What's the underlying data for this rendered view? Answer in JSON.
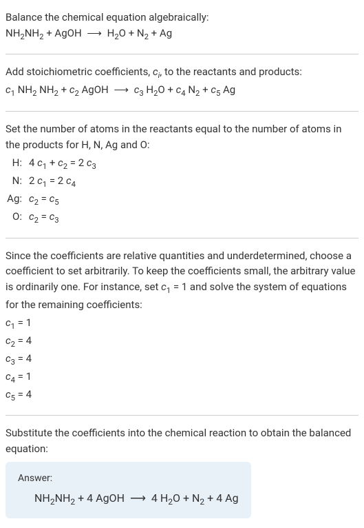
{
  "chart_data": {
    "type": "table",
    "title": "Atom balance equations",
    "elements": [
      "H",
      "N",
      "Ag",
      "O"
    ],
    "equations": {
      "H": "4 c1 + c2 = 2 c3",
      "N": "2 c1 = 2 c4",
      "Ag": "c2 = c5",
      "O": "c2 = c3"
    },
    "solution": {
      "c1": 1,
      "c2": 4,
      "c3": 4,
      "c4": 1,
      "c5": 4
    },
    "reactants": [
      {
        "coefficient": 1,
        "formula": "NH2NH2"
      },
      {
        "coefficient": 4,
        "formula": "AgOH"
      }
    ],
    "products": [
      {
        "coefficient": 4,
        "formula": "H2O"
      },
      {
        "coefficient": 1,
        "formula": "N2"
      },
      {
        "coefficient": 4,
        "formula": "Ag"
      }
    ]
  },
  "s1": {
    "line1": "Balance the chemical equation algebraically:",
    "eq_a": "NH",
    "eq_b": "NH",
    "eq_c": " + AgOH ",
    "arrow": "⟶",
    "eq_d": " H",
    "eq_e": "O + N",
    "eq_f": " + Ag",
    "two": "2"
  },
  "s2": {
    "line1a": "Add stoichiometric coefficients, ",
    "ci": "c",
    "ci_sub": "i",
    "line1b": ", to the reactants and products:",
    "c1": "c",
    "c2": "c",
    "c3": "c",
    "c4": "c",
    "c5": "c",
    "n1": "1",
    "n2": "2",
    "n3": "3",
    "n4": "4",
    "n5": "5",
    "sp_nh": " NH",
    "sp_agoh": " AgOH ",
    "sp_h": " H",
    "sp_o_n": "O + ",
    "sp_n": " N",
    "sp_plus": " + ",
    "sp_ag": " Ag",
    "arrow": "⟶",
    "two": "2"
  },
  "s3": {
    "line1": "Set the number of atoms in the reactants equal to the number of atoms in the products for H, N, Ag and O:",
    "H_label": "H:",
    "N_label": "N:",
    "Ag_label": "Ag:",
    "O_label": "O:",
    "H_a": "4 ",
    "H_c1": "c",
    "H_1": "1",
    "H_b": " + ",
    "H_c2": "c",
    "H_2": "2",
    "H_c": " = 2 ",
    "H_c3": "c",
    "H_3": "3",
    "N_a": "2 ",
    "N_c1": "c",
    "N_1": "1",
    "N_b": " = 2 ",
    "N_c4": "c",
    "N_4": "4",
    "Ag_c2": "c",
    "Ag_2": "2",
    "Ag_b": " = ",
    "Ag_c5": "c",
    "Ag_5": "5",
    "O_c2": "c",
    "O_2": "2",
    "O_b": " = ",
    "O_c3": "c",
    "O_3": "3"
  },
  "s4": {
    "line1a": "Since the coefficients are relative quantities and underdetermined, choose a coefficient to set arbitrarily. To keep the coefficients small, the arbitrary value is ordinarily one. For instance, set ",
    "c1": "c",
    "n1": "1",
    "line1b": " = 1 and solve the system of equations for the remaining coefficients:",
    "r1_c": "c",
    "r1_n": "1",
    "r1_v": " = 1",
    "r2_c": "c",
    "r2_n": "2",
    "r2_v": " = 4",
    "r3_c": "c",
    "r3_n": "3",
    "r3_v": " = 4",
    "r4_c": "c",
    "r4_n": "4",
    "r4_v": " = 1",
    "r5_c": "c",
    "r5_n": "5",
    "r5_v": " = 4"
  },
  "s5": {
    "line1": "Substitute the coefficients into the chemical reaction to obtain the balanced equation:"
  },
  "answer": {
    "label": "Answer:",
    "a": "NH",
    "b": "NH",
    "c": " + 4 AgOH ",
    "arrow": "⟶",
    "d": " 4 H",
    "e": "O + N",
    "f": " + 4 Ag",
    "two": "2"
  }
}
